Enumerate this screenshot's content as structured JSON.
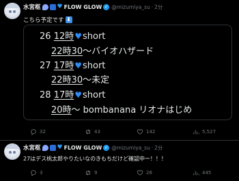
{
  "tweets": [
    {
      "author_name": "水宮枢",
      "brand": "FLOW GLOW",
      "handle": "@mizumiya_su",
      "separator": "·",
      "time": "2分",
      "text": "こちら予定です",
      "schedule": [
        {
          "day": "26",
          "time": "12時",
          "title": "short"
        },
        {
          "time": "22時30",
          "title": "～バイオハザード"
        },
        {
          "day": "27",
          "time": "17時",
          "title": "short"
        },
        {
          "time": "22時30",
          "title": "～未定"
        },
        {
          "day": "28",
          "time": "17時",
          "title": "short"
        },
        {
          "time": "20時",
          "title": "～ bombanana リオナはじめ"
        }
      ],
      "stats": {
        "replies": "32",
        "retweets": "43",
        "likes": "142",
        "views": "5,527"
      }
    },
    {
      "author_name": "水宮枢",
      "brand": "FLOW GLOW",
      "handle": "@mizumiya_su",
      "separator": "·",
      "time": "2分",
      "text": "27はデス桃太郎やりたいなのきもちだけど確認中ー！！！",
      "stats": {
        "replies": "3",
        "retweets": "9",
        "likes": "26",
        "views": "445"
      }
    }
  ],
  "icons": {
    "reply": "reply-icon",
    "retweet": "retweet-icon",
    "like": "heart-icon",
    "views": "views-icon",
    "verified": "verified-icon"
  },
  "colors": {
    "background": "#000000",
    "text": "#e7e9ea",
    "muted": "#71767b",
    "accent": "#1d9bf0"
  }
}
